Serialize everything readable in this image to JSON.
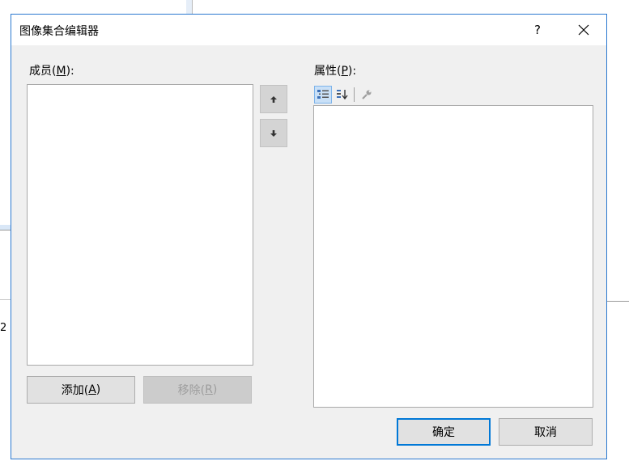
{
  "background": {
    "fragment_text": "2"
  },
  "dialog": {
    "title": "图像集合编辑器",
    "help_glyph": "?",
    "members_label_pre": "成员(",
    "members_label_key": "M",
    "members_label_post": "):",
    "properties_label_pre": "属性(",
    "properties_label_key": "P",
    "properties_label_post": "):",
    "add_pre": "添加(",
    "add_key": "A",
    "add_post": ")",
    "remove_pre": "移除(",
    "remove_key": "R",
    "remove_post": ")",
    "ok_label": "确定",
    "cancel_label": "取消",
    "icons": [
      "help-icon",
      "close-icon",
      "arrow-up-icon",
      "arrow-down-icon",
      "categorized-icon",
      "alphabetical-sort-icon",
      "property-pages-icon"
    ]
  },
  "colors": {
    "accent": "#0078d7",
    "dialog_bg": "#f0f0f0",
    "border": "#2b79d0"
  }
}
